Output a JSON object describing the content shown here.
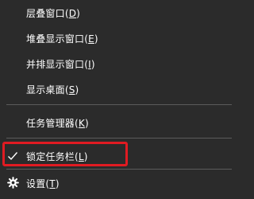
{
  "context_menu": {
    "items": [
      {
        "label": "层叠窗口",
        "accelerator": "D"
      },
      {
        "label": "堆叠显示窗口",
        "accelerator": "E"
      },
      {
        "label": "并排显示窗口",
        "accelerator": "I"
      },
      {
        "label": "显示桌面",
        "accelerator": "S"
      },
      {
        "label": "任务管理器",
        "accelerator": "K"
      },
      {
        "label": "锁定任务栏",
        "accelerator": "L",
        "checked": true
      },
      {
        "label": "设置",
        "accelerator": "T",
        "icon": "gear-icon"
      }
    ]
  },
  "colors": {
    "menu_background": "#2b2b2b",
    "text": "#ffffff",
    "separator": "#5b5b5b",
    "highlight_border": "#e01b22"
  },
  "icons": [
    "checkmark-icon",
    "gear-icon"
  ]
}
